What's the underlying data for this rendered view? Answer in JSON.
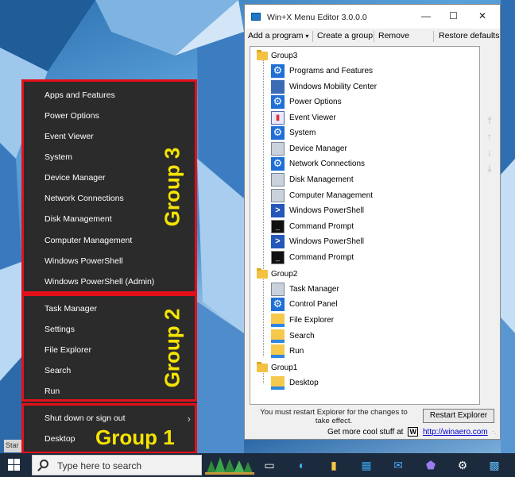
{
  "winx_menu": {
    "group3": [
      "Apps and Features",
      "Power Options",
      "Event Viewer",
      "System",
      "Device Manager",
      "Network Connections",
      "Disk Management",
      "Computer Management",
      "Windows PowerShell",
      "Windows PowerShell (Admin)"
    ],
    "group2": [
      "Task Manager",
      "Settings",
      "File Explorer",
      "Search",
      "Run"
    ],
    "group1": [
      "Shut down or sign out",
      "Desktop"
    ],
    "labels": {
      "g3": "Group 3",
      "g2": "Group 2",
      "g1": "Group 1"
    },
    "start_stub": "Star"
  },
  "editor": {
    "title": "Win+X Menu Editor 3.0.0.0",
    "menu": {
      "add": "Add a program",
      "create": "Create a group",
      "remove": "Remove",
      "restore": "Restore defaults"
    },
    "tree": {
      "group3": {
        "name": "Group3",
        "items": [
          {
            "label": "Programs and Features",
            "icon": "gear-icon"
          },
          {
            "label": "Windows Mobility Center",
            "icon": "mobility-icon"
          },
          {
            "label": "Power Options",
            "icon": "gear-icon"
          },
          {
            "label": "Event Viewer",
            "icon": "event-viewer-icon"
          },
          {
            "label": "System",
            "icon": "gear-icon"
          },
          {
            "label": "Device Manager",
            "icon": "device-manager-icon"
          },
          {
            "label": "Network Connections",
            "icon": "gear-icon"
          },
          {
            "label": "Disk Management",
            "icon": "disk-icon"
          },
          {
            "label": "Computer Management",
            "icon": "computer-icon"
          },
          {
            "label": "Windows PowerShell",
            "icon": "powershell-icon"
          },
          {
            "label": "Command Prompt",
            "icon": "cmd-icon"
          },
          {
            "label": "Windows PowerShell",
            "icon": "powershell-icon"
          },
          {
            "label": "Command Prompt",
            "icon": "cmd-icon"
          }
        ]
      },
      "group2": {
        "name": "Group2",
        "items": [
          {
            "label": "Task Manager",
            "icon": "task-manager-icon"
          },
          {
            "label": "Control Panel",
            "icon": "gear-icon"
          },
          {
            "label": "File Explorer",
            "icon": "file-explorer-icon"
          },
          {
            "label": "Search",
            "icon": "file-explorer-icon"
          },
          {
            "label": "Run",
            "icon": "file-explorer-icon"
          }
        ]
      },
      "group1": {
        "name": "Group1",
        "items": [
          {
            "label": "Desktop",
            "icon": "file-explorer-icon"
          }
        ]
      }
    },
    "restart_note": "You must restart Explorer for the changes to take effect.",
    "restart_button": "Restart Explorer",
    "cool_text": "Get more cool stuff at",
    "link": "http://winaero.com"
  },
  "taskbar": {
    "search_placeholder": "Type here to search"
  }
}
